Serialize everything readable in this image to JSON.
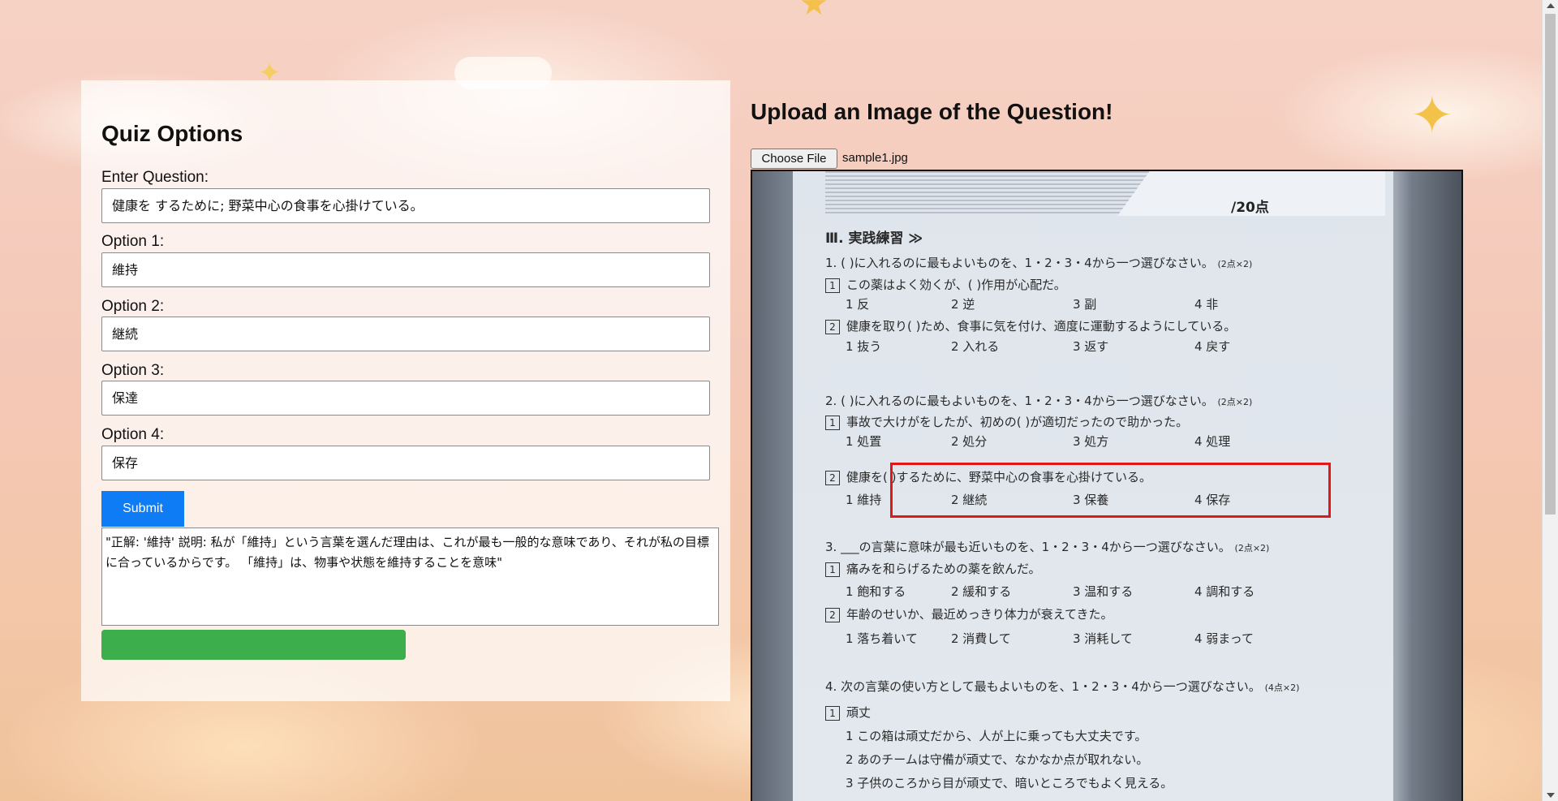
{
  "quiz": {
    "heading": "Quiz Options",
    "question_label": "Enter Question:",
    "question_value": "健康を するために; 野菜中心の食事を心掛けている。",
    "options": [
      {
        "label": "Option 1:",
        "value": "維持"
      },
      {
        "label": "Option 2:",
        "value": "継続"
      },
      {
        "label": "Option 3:",
        "value": "保達"
      },
      {
        "label": "Option 4:",
        "value": "保存"
      }
    ],
    "submit_label": "Submit",
    "result_text": "\"正解: '維持'  説明: 私が「維持」という言葉を選んだ理由は、これが最も一般的な意味であり、それが私の目標に合っているからです。 「維持」は、物事や状態を維持することを意味\""
  },
  "upload": {
    "heading": "Upload an Image of the Question!",
    "choose_file_label": "Choose File",
    "file_name": "sample1.jpg"
  },
  "photo": {
    "score": "/20点",
    "section_title": "Ⅲ. 実践練習 ≫",
    "q1_heading": "1. (  )に入れるのに最もよいものを、1・2・3・4から一つ選びなさい。",
    "q1_points": "(2点×2)",
    "q1_1": "この薬はよく効くが、(  )作用が心配だ。",
    "q1_1_choices": [
      "1 反",
      "2 逆",
      "3 副",
      "4 非"
    ],
    "q1_2": "健康を取り(  )ため、食事に気を付け、適度に運動するようにしている。",
    "q1_2_choices": [
      "1 抜う",
      "2 入れる",
      "3 返す",
      "4 戻す"
    ],
    "q2_heading": "2. (  )に入れるのに最もよいものを、1・2・3・4から一つ選びなさい。",
    "q2_points": "(2点×2)",
    "q2_1": "事故で大けがをしたが、初めの(  )が適切だったので助かった。",
    "q2_1_choices": [
      "1 処置",
      "2 処分",
      "3 処方",
      "4 処理"
    ],
    "q2_2": "健康を(  )するために、野菜中心の食事を心掛けている。",
    "q2_2_choices": [
      "1 維持",
      "2 継続",
      "3 保養",
      "4 保存"
    ],
    "q3_heading": "3. ___の言葉に意味が最も近いものを、1・2・3・4から一つ選びなさい。",
    "q3_points": "(2点×2)",
    "q3_1": "痛みを和らげるための薬を飲んだ。",
    "q3_1_choices": [
      "1 飽和する",
      "2 緩和する",
      "3 温和する",
      "4 調和する"
    ],
    "q3_2": "年齢のせいか、最近めっきり体力が衰えてきた。",
    "q3_2_choices": [
      "1 落ち着いて",
      "2 消費して",
      "3 消耗して",
      "4 弱まって"
    ],
    "q4_heading": "4. 次の言葉の使い方として最もよいものを、1・2・3・4から一つ選びなさい。",
    "q4_points": "(4点×2)",
    "q4_1": "頑丈",
    "q4_1_lines": [
      "1 この箱は頑丈だから、人が上に乗っても大丈夫です。",
      "2 あのチームは守備が頑丈で、なかなか点が取れない。",
      "3 子供のころから目が頑丈で、暗いところでもよく見える。"
    ]
  },
  "colors": {
    "submit_bg": "#0d7cf5",
    "progress_bar": "#3cae4b",
    "highlight_box": "#e01818"
  }
}
